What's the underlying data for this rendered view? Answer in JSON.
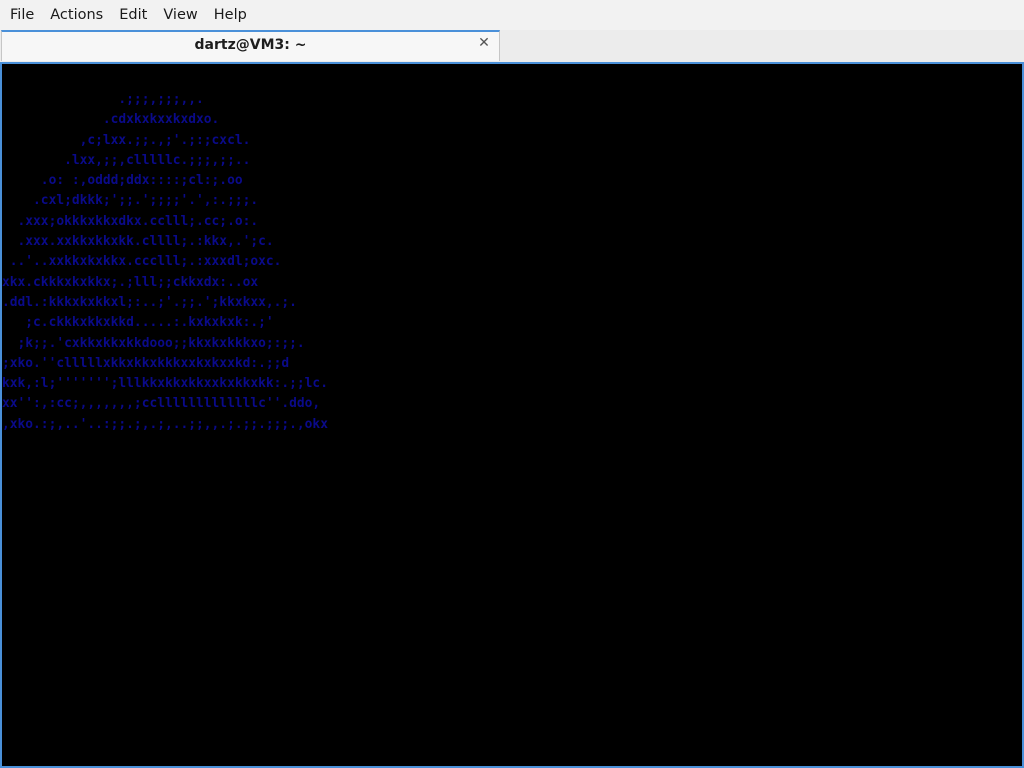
{
  "menubar": {
    "items": [
      "File",
      "Actions",
      "Edit",
      "View",
      "Help"
    ]
  },
  "tabs": [
    {
      "title": "dartz@VM3: ~",
      "close_icon": "close-icon"
    }
  ],
  "terminal": {
    "foreground": "#0a0a8a",
    "background": "#000000",
    "text": "               .;;;,;;;,,.\n             .cdxkxkxxkxdxo.\n          ,c;lxx.;;.,;'.;:;cxcl.\n        .lxx,;;,clllllc.;;;,;;..\n     .o: :,oddd;ddx::::;cl:;.oo\n    .cxl;dkkk;';;.';;;;'.',:.;;;.\n  .xxx;okkkxkkxdkx.cclll;.cc;.o:.\n  .xxx.xxkkxkkxkk.cllll;.:kkx,.';c.\n ..'..xxkkxkxkkx.ccclll;.:xxxdl;oxc.\nxkx.ckkkxkxkkx;.;lll;;ckkxdx:..ox\n.ddl.:kkkxkxkkxl;:..;'.;;.';kkxkxx,.;.\n   ;c.ckkkxkkxkkd.....:.kxkxkxk:.;'\n  ;k;;.'cxkkxkkxkkdooo;;kkxkxkkkxo;:;;.\n;xko.''clllllxkkxkkxkkkxxkxkxxkd:.;;d\nkxk,:l;''''''';lllkkxkkxkkxxkxkkxkk:.;;lc.\nxx'':,:cc;,,,,,,,;cclllllllllllllc''.ddo,\n,xko.:;,..'..:;;.;,.;,..;;,,.;.;;.;;;.,okx"
  }
}
